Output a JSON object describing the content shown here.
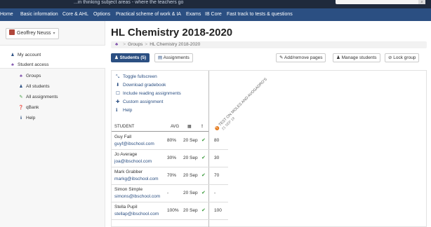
{
  "topstrip": {
    "tagline": "...in thinking subject areas - where the teachers go"
  },
  "nav": [
    "Home",
    "Basic information",
    "Core & AHL",
    "Options",
    "Practical scheme of work & IA",
    "Exams",
    "IB Core",
    "Fast track to tests & questions"
  ],
  "sidebar": {
    "user": "Geoffrey Neuss",
    "items": [
      {
        "label": "My account",
        "icon": "user-icon"
      },
      {
        "label": "Student access",
        "icon": "users-icon"
      },
      {
        "label": "Groups",
        "icon": "users-icon"
      },
      {
        "label": "All students",
        "icon": "user-icon"
      },
      {
        "label": "All assignments",
        "icon": "pencil-icon"
      },
      {
        "label": "qBank",
        "icon": "question-icon"
      },
      {
        "label": "Help",
        "icon": "info-icon"
      }
    ]
  },
  "page": {
    "title": "HL Chemistry 2018-2020",
    "breadcrumb": [
      "Groups",
      "HL Chemistry 2018-2020"
    ]
  },
  "tabs": {
    "students": "Students (5)",
    "assignments": "Assignments"
  },
  "actions": {
    "add_remove": "Add/remove pages",
    "manage_students": "Manage students",
    "lock_group": "Lock group"
  },
  "menu": [
    "Toggle fullscreen",
    "Download gradebook",
    "Include reading assignments",
    "Custom assignment",
    "Help"
  ],
  "table": {
    "headers": {
      "student": "STUDENT",
      "avg": "AVG",
      "date_icon": "calendar-icon",
      "flag": "!"
    },
    "assignment_title": "TEST ON MOLES AND AVOGADRO'S",
    "assignment_date": "21 SEP 18",
    "rows": [
      {
        "name": "Guy Fall",
        "email": "guyf@ibschool.com",
        "avg": "80%",
        "date": "20 Sep",
        "score": "80"
      },
      {
        "name": "Jo Average",
        "email": "joa@ibschool.com",
        "avg": "30%",
        "date": "20 Sep",
        "score": "30"
      },
      {
        "name": "Mark Grabber",
        "email": "markg@ibschool.com",
        "avg": "70%",
        "date": "20 Sep",
        "score": "70"
      },
      {
        "name": "Simon Simple",
        "email": "simons@ibschool.com",
        "avg": "-",
        "date": "20 Sep",
        "score": "-"
      },
      {
        "name": "Stella Pupil",
        "email": "stellap@ibschool.com",
        "avg": "100%",
        "date": "20 Sep",
        "score": "100"
      }
    ]
  },
  "colors": {
    "nav": "#2b4f82",
    "accent": "#2b4f82",
    "check": "#3a9a3a",
    "qbank": "#e57c20"
  }
}
